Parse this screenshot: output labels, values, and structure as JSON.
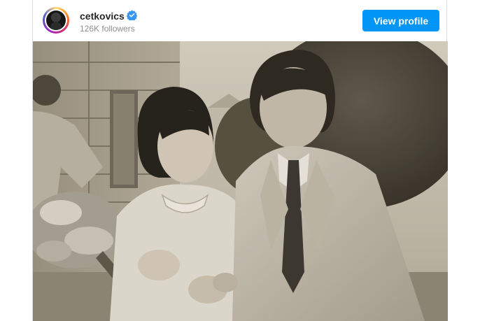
{
  "profile": {
    "username": "cetkovics",
    "followers": "126K followers",
    "verified": true,
    "view_profile_label": "View profile"
  },
  "colors": {
    "button_bg": "#0095f6",
    "verified_badge": "#3897f0"
  },
  "icons": {
    "verified": "verified-badge-icon",
    "avatar": "profile-avatar"
  }
}
